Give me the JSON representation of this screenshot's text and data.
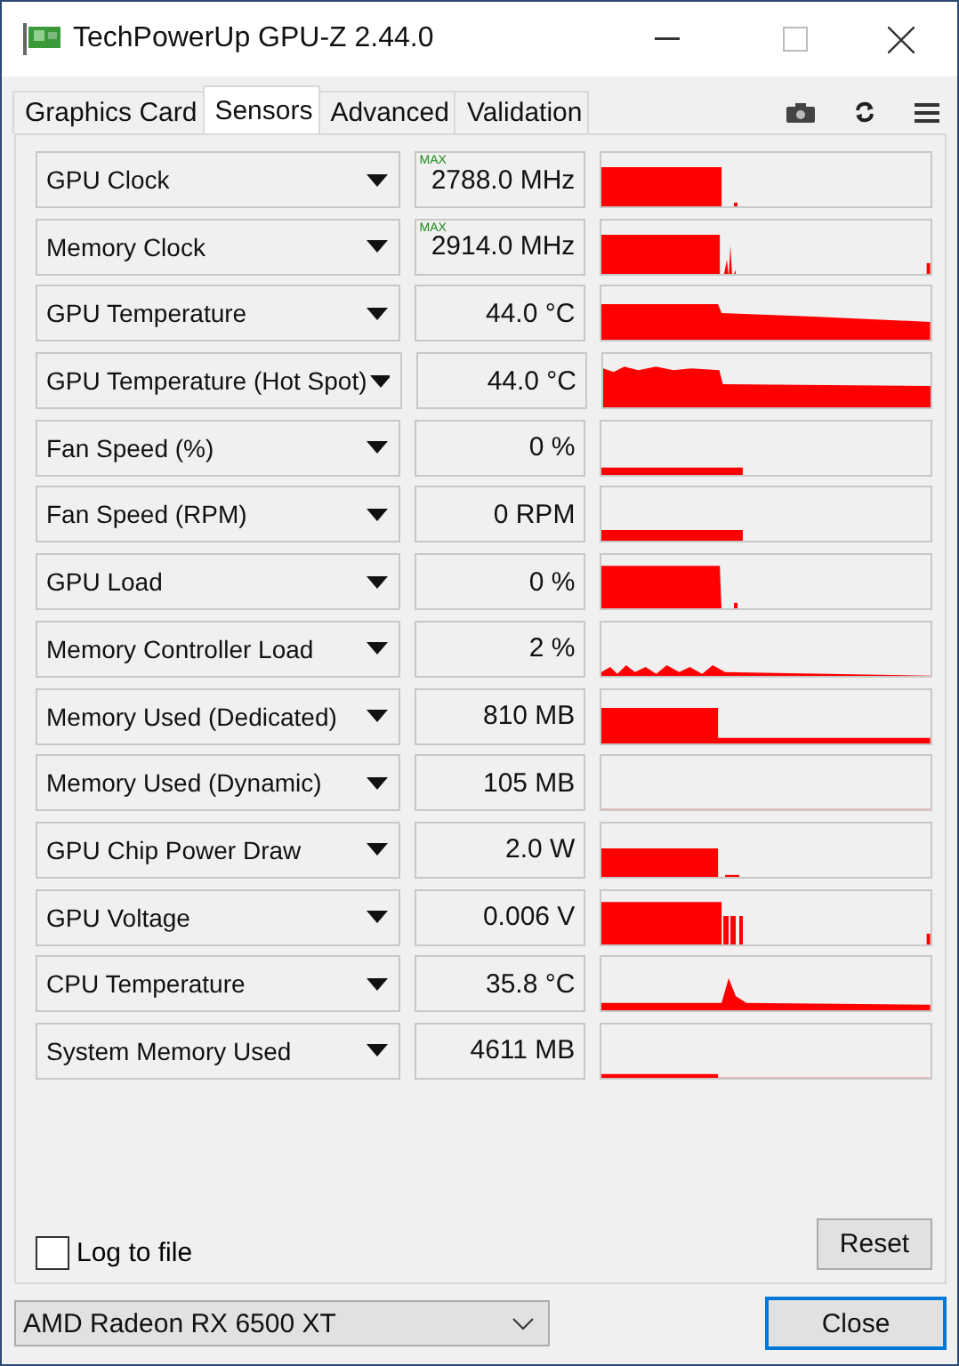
{
  "window": {
    "title": "TechPowerUp GPU-Z 2.44.0"
  },
  "tabs": [
    {
      "label": "Graphics Card",
      "selected": false
    },
    {
      "label": "Sensors",
      "selected": true
    },
    {
      "label": "Advanced",
      "selected": false
    },
    {
      "label": "Validation",
      "selected": false
    }
  ],
  "sensors": [
    {
      "name": "GPU Clock",
      "value": "2788.0 MHz",
      "badge": "MAX"
    },
    {
      "name": "Memory Clock",
      "value": "2914.0 MHz",
      "badge": "MAX"
    },
    {
      "name": "GPU Temperature",
      "value": "44.0 °C"
    },
    {
      "name": "GPU Temperature (Hot Spot)",
      "value": "44.0 °C"
    },
    {
      "name": "Fan Speed (%)",
      "value": "0 %"
    },
    {
      "name": "Fan Speed (RPM)",
      "value": "0 RPM"
    },
    {
      "name": "GPU Load",
      "value": "0 %"
    },
    {
      "name": "Memory Controller Load",
      "value": "2 %"
    },
    {
      "name": "Memory Used (Dedicated)",
      "value": "810 MB"
    },
    {
      "name": "Memory Used (Dynamic)",
      "value": "105 MB"
    },
    {
      "name": "GPU Chip Power Draw",
      "value": "2.0 W"
    },
    {
      "name": "GPU Voltage",
      "value": "0.006 V"
    },
    {
      "name": "CPU Temperature",
      "value": "35.8 °C"
    },
    {
      "name": "System Memory Used",
      "value": "4611 MB"
    }
  ],
  "log_to_file": {
    "label": "Log to file",
    "checked": false
  },
  "reset_button": "Reset",
  "gpu_select": {
    "value": "AMD Radeon RX 6500 XT"
  },
  "close_button": "Close"
}
